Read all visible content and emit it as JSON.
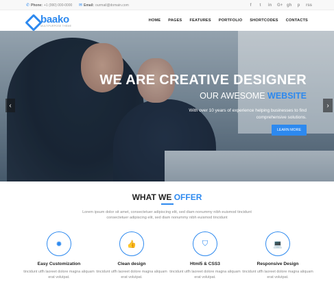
{
  "topbar": {
    "phone_label": "Phone:",
    "phone_value": "+1 (990) 000-0000",
    "email_label": "Email:",
    "email_value": "ourmail@domain.com",
    "social": [
      "f",
      "t",
      "in",
      "G+",
      "gh",
      "p",
      "rss"
    ]
  },
  "brand": {
    "name": "baako",
    "tagline": "MULTIPURPOSE THEME",
    "color": "#2d89ef"
  },
  "nav": {
    "items": [
      "HOME",
      "PAGES",
      "FEATURES",
      "PORTFOLIO",
      "SHORTCODES",
      "CONTACTS"
    ]
  },
  "hero": {
    "title": "WE ARE CREATIVE DESIGNER",
    "subtitle_prefix": "OUR AWESOME",
    "subtitle_highlight": "WEBSITE",
    "description": "With over 10 years of experience helping businesses to find comprehensive solutions.",
    "button_label": "LEARN MORE",
    "prev_arrow": "‹",
    "next_arrow": "›"
  },
  "offer": {
    "title_prefix": "WHAT WE",
    "title_highlight": "OFFER",
    "description": "Lorem ipsum dolor sit amet, consectetuer adipiscing elit, sed diam nonummy nibh euismod tincidunt consectetuer adipiscing elit, sed diam nonummy nibh euismod tincidunt",
    "features": [
      {
        "icon": "gear-icon",
        "glyph": "✹",
        "title": "Easy Customization",
        "desc": "tincidunt utfh laoreet dolore magna aliquam erat volutpat."
      },
      {
        "icon": "thumbs-up-icon",
        "glyph": "👍",
        "title": "Clean design",
        "desc": "tincidunt utfh laoreet dolore magna aliquam erat volutpat."
      },
      {
        "icon": "html5-icon",
        "glyph": "⛉",
        "title": "Html5 & CSS3",
        "desc": "tincidunt utfh laoreet dolore magna aliquam erat volutpat."
      },
      {
        "icon": "laptop-icon",
        "glyph": "💻",
        "title": "Responsive Design",
        "desc": "tincidunt utfh laoreet dolore magna aliquam erat volutpat."
      }
    ]
  }
}
